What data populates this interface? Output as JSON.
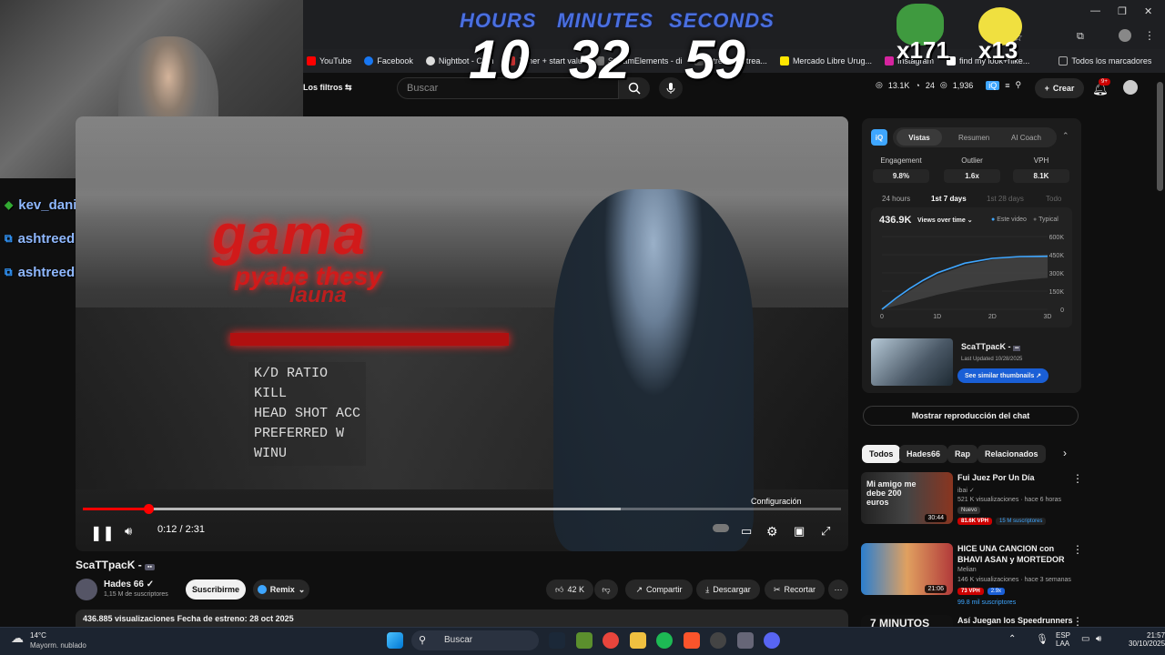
{
  "bookmarks": [
    "YouTube",
    "Facebook",
    "Nightbot - Com",
    "Timer + start valu",
    "StreamElements - di",
    "Stream / Strea...",
    "Mercado Libre Urug...",
    "Instagram",
    "find my look+nike...",
    "Todos los marcadores"
  ],
  "timer": {
    "hours_label": "HOURS",
    "minutes_label": "MINUTES",
    "seconds_label": "SECONDS",
    "hours": "10",
    "minutes": "32",
    "seconds": "59"
  },
  "emote_counts": {
    "a": "x171",
    "b": "x13"
  },
  "chat": [
    {
      "user": "kev_daniiel",
      "sep": ":"
    },
    {
      "user": "ashtreed",
      "sep": ":"
    },
    {
      "user": "ashtreed",
      "sep": ":"
    }
  ],
  "header": {
    "filters": "Los filtros",
    "search_placeholder": "Buscar",
    "crear": "Crear",
    "notif_badge": "9+",
    "stats": [
      "13.1K",
      "24",
      "1,936"
    ]
  },
  "video": {
    "overlay_title": "gama",
    "overlay_sub": "pyabe thesy",
    "overlay_sub2": "launa",
    "hud": "K/D RATIO\nKILL\nHEAD SHOT ACC\nPREFERRED W\nWINU",
    "time": "0:12 / 2:31",
    "tooltip": "Configuración",
    "progress_fraction": 0.087,
    "buffer_fraction": 0.71
  },
  "below": {
    "title": "ScaTTpacK -",
    "channel": "Hades 66",
    "subs": "1,15 M de suscriptores",
    "subscribe": "Suscribirme",
    "remix": "Remix",
    "likes": "42 K",
    "share": "Compartir",
    "download": "Descargar",
    "clip": "Recortar",
    "desc": "436.885 visualizaciones  Fecha de estreno: 28 oct 2025"
  },
  "ext": {
    "tabs": [
      "Vistas",
      "Resumen",
      "AI Coach"
    ],
    "metrics": [
      {
        "label": "Engagement",
        "value": "9.8%"
      },
      {
        "label": "Outlier",
        "value": "1.6x"
      },
      {
        "label": "VPH",
        "value": "8.1K"
      }
    ],
    "ranges": [
      "24 hours",
      "1st 7 days",
      "1st 28 days",
      "Todo"
    ],
    "views": "436.9K",
    "views_mode": "Views over time",
    "legend_a": "Este video",
    "legend_b": "Typical",
    "yticks": [
      "600K",
      "450K",
      "300K",
      "150K",
      "0"
    ],
    "xticks": [
      "0",
      "1D",
      "2D",
      "3D"
    ],
    "thumb_title": "ScaTTpacK -",
    "thumb_updated": "Last Updated 10/28/2025",
    "thumb_btn": "See similar thumbnails"
  },
  "chart_data": {
    "type": "line",
    "title": "",
    "x": [
      0,
      0.25,
      0.5,
      0.75,
      1,
      1.5,
      2,
      2.5,
      3
    ],
    "xlabels": [
      "0",
      "1D",
      "2D",
      "3D"
    ],
    "series": [
      {
        "name": "Este video",
        "values": [
          0,
          90000,
          170000,
          240000,
          300000,
          380000,
          420000,
          435000,
          437000
        ]
      }
    ],
    "typical_band": {
      "lower": [
        0,
        30000,
        60000,
        90000,
        120000,
        170000,
        210000,
        240000,
        260000
      ],
      "upper": [
        0,
        80000,
        150000,
        220000,
        280000,
        360000,
        410000,
        440000,
        450000
      ]
    },
    "ylim": [
      0,
      600000
    ]
  },
  "replay": "Mostrar reproducción del chat",
  "chips": [
    "Todos",
    "Hades66",
    "Rap",
    "Relacionados"
  ],
  "recs": [
    {
      "title": "Fui Juez Por Un Día",
      "channel": "ibai",
      "meta": "521 K visualizaciones · hace 6 horas",
      "badge": "Nuevo",
      "vph": "81.6K VPH",
      "subs": "15 M suscriptores",
      "dur": "30:44",
      "thumbtext": "Mi amigo me debe 200 euros"
    },
    {
      "title": "HICE UNA CANCION con BHAVI ASAN y MORTEDOR",
      "channel": "Melian",
      "meta": "146 K visualizaciones · hace 3 semanas",
      "vph": "73 VPH",
      "ratio": "2.9x",
      "subs": "99.8 mil suscriptores",
      "dur": "21:06"
    },
    {
      "title": "Así Juegan los Speedrunners de",
      "thumbtext": "7 MINUTOS"
    }
  ],
  "taskbar": {
    "weather_temp": "14°C",
    "weather_desc": "Mayorm. nublado",
    "search": "Buscar",
    "lang": "ESP",
    "lang2": "LAA",
    "time": "21:57",
    "date": "30/10/2025"
  },
  "colors": {
    "accent": "#ff0000",
    "ext_accent": "#3ea6ff",
    "timer_label": "#4a6fe0"
  }
}
